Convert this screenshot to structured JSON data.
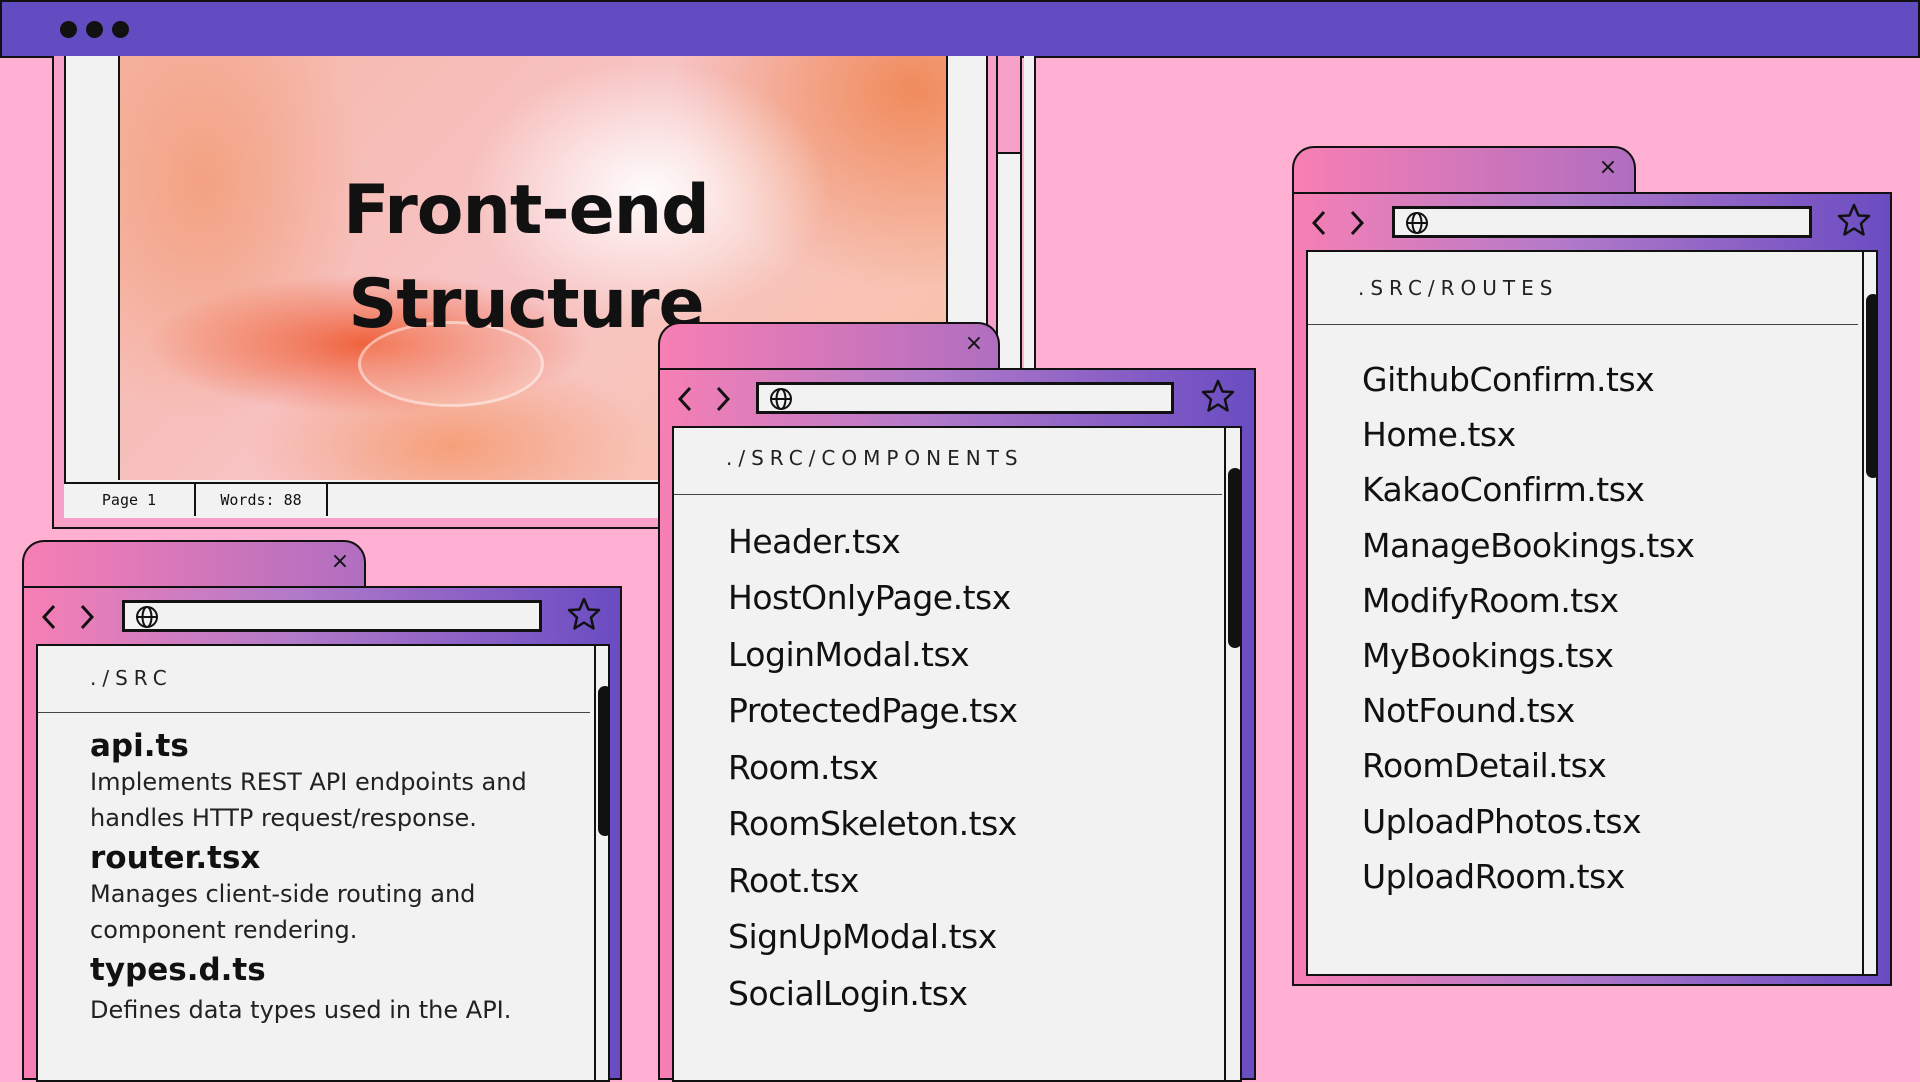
{
  "topbar": {
    "dots": [
      "window-dot",
      "window-dot",
      "window-dot"
    ]
  },
  "document": {
    "title_line1": "Front-end",
    "title_line2": "Structure",
    "status_page": "Page 1",
    "status_words": "Words: 88"
  },
  "src_window": {
    "path": "./SRC",
    "items": [
      {
        "name": "api.ts",
        "desc1": "Implements REST API endpoints and",
        "desc2": "handles HTTP request/response."
      },
      {
        "name": "router.tsx",
        "desc1": "Manages client-side routing and",
        "desc2": "component rendering."
      },
      {
        "name": "types.d.ts",
        "desc1": "Defines data types used in the API.",
        "desc2": ""
      }
    ]
  },
  "components_window": {
    "path": "./SRC/COMPONENTS",
    "files": [
      "Header.tsx",
      "HostOnlyPage.tsx",
      "LoginModal.tsx",
      "ProtectedPage.tsx",
      "Room.tsx",
      "RoomSkeleton.tsx",
      "Root.tsx",
      "SignUpModal.tsx",
      "SocialLogin.tsx"
    ]
  },
  "routes_window": {
    "path": ".SRC/ROUTES",
    "files": [
      "GithubConfirm.tsx",
      "Home.tsx",
      "KakaoConfirm.tsx",
      "ManageBookings.tsx",
      "ModifyRoom.tsx",
      "MyBookings.tsx",
      "NotFound.tsx",
      "RoomDetail.tsx",
      "UploadPhotos.tsx",
      "UploadRoom.tsx"
    ]
  },
  "icons": {
    "close": "×",
    "back": "chevron-left-icon",
    "forward": "chevron-right-icon",
    "globe": "globe-icon",
    "star": "star-icon"
  },
  "colors": {
    "background": "#ffb0d2",
    "topbar": "#614cc1",
    "pink": "#f77fb4",
    "purple": "#6a4cc2",
    "panel": "#f2f2f2"
  }
}
